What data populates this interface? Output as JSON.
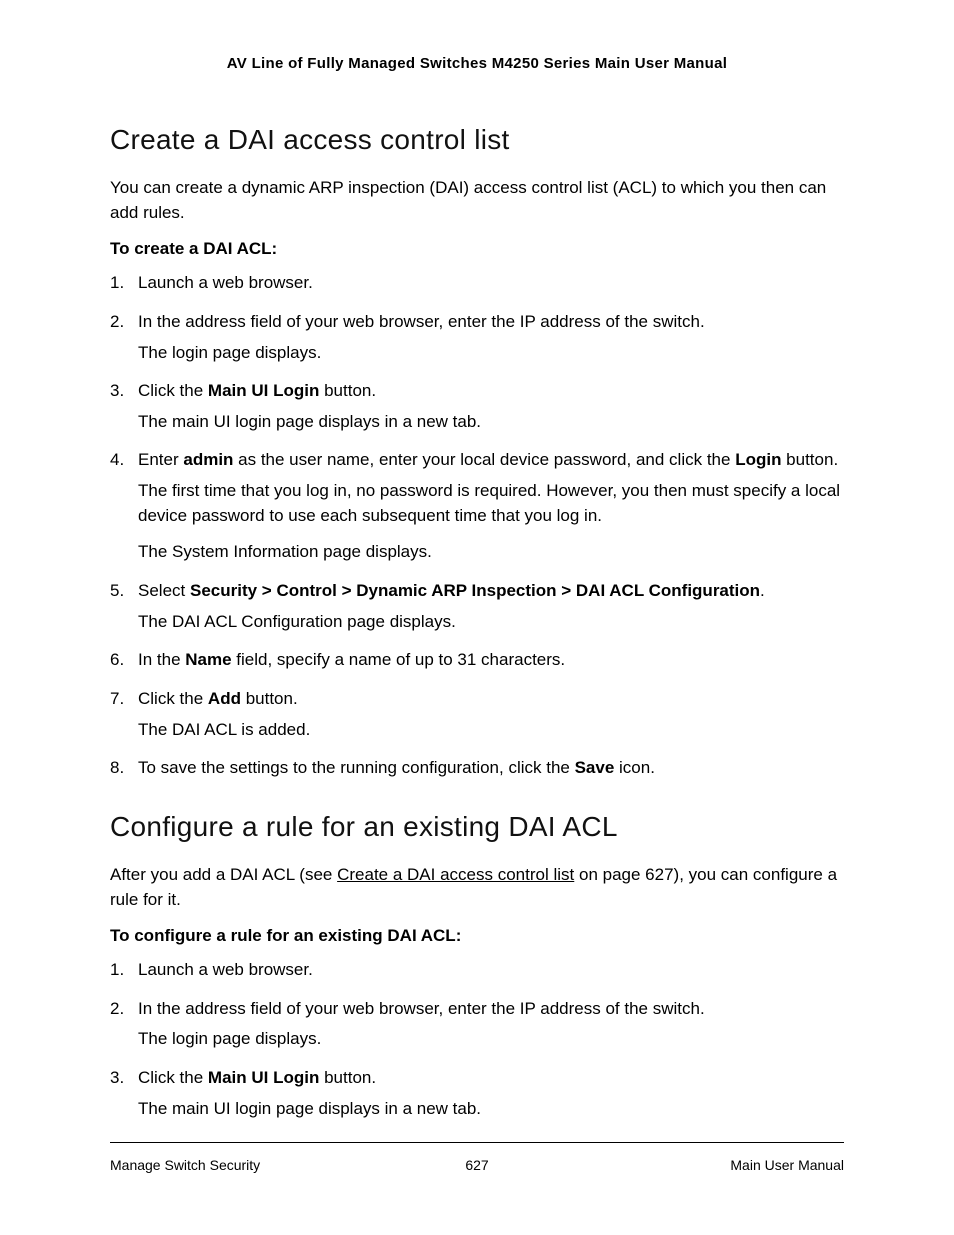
{
  "header": {
    "title": "AV Line of Fully Managed Switches M4250 Series Main User Manual"
  },
  "section1": {
    "heading": "Create a DAI access control list",
    "intro": "You can create a dynamic ARP inspection (DAI) access control list (ACL) to which you then can add rules.",
    "subheading": "To create a DAI ACL:",
    "steps": {
      "s1": "Launch a web browser.",
      "s2_line1": "In the address field of your web browser, enter the IP address of the switch.",
      "s2_line2": "The login page displays.",
      "s3_pre": "Click the ",
      "s3_bold": "Main UI Login",
      "s3_post": " button.",
      "s3_line2": "The main UI login page displays in a new tab.",
      "s4_pre": "Enter ",
      "s4_bold1": "admin",
      "s4_mid": " as the user name, enter your local device password, and click the ",
      "s4_bold2": "Login",
      "s4_post": " button.",
      "s4_line2": "The first time that you log in, no password is required. However, you then must specify a local device password to use each subsequent time that you log in.",
      "s4_line3": "The System Information page displays.",
      "s5_pre": "Select ",
      "s5_bold": "Security > Control > Dynamic ARP Inspection > DAI ACL Configuration",
      "s5_post": ".",
      "s5_line2": "The DAI ACL Configuration page displays.",
      "s6_pre": "In the ",
      "s6_bold": "Name",
      "s6_post": " field, specify a name of up to 31 characters.",
      "s7_pre": "Click the ",
      "s7_bold": "Add",
      "s7_post": " button.",
      "s7_line2": "The DAI ACL is added.",
      "s8_pre": "To save the settings to the running configuration, click the ",
      "s8_bold": "Save",
      "s8_post": " icon."
    }
  },
  "section2": {
    "heading": "Configure a rule for an existing DAI ACL",
    "intro_pre": "After you add a DAI ACL (see ",
    "intro_link": "Create a DAI access control list",
    "intro_mid": " on page ",
    "intro_page": "627",
    "intro_post": "), you can configure a rule for it.",
    "subheading": "To configure a rule for an existing DAI ACL:",
    "steps": {
      "s1": "Launch a web browser.",
      "s2_line1": "In the address field of your web browser, enter the IP address of the switch.",
      "s2_line2": "The login page displays.",
      "s3_pre": "Click the ",
      "s3_bold": "Main UI Login",
      "s3_post": " button.",
      "s3_line2": "The main UI login page displays in a new tab."
    }
  },
  "footer": {
    "left": "Manage Switch Security",
    "center": "627",
    "right": "Main User Manual"
  }
}
